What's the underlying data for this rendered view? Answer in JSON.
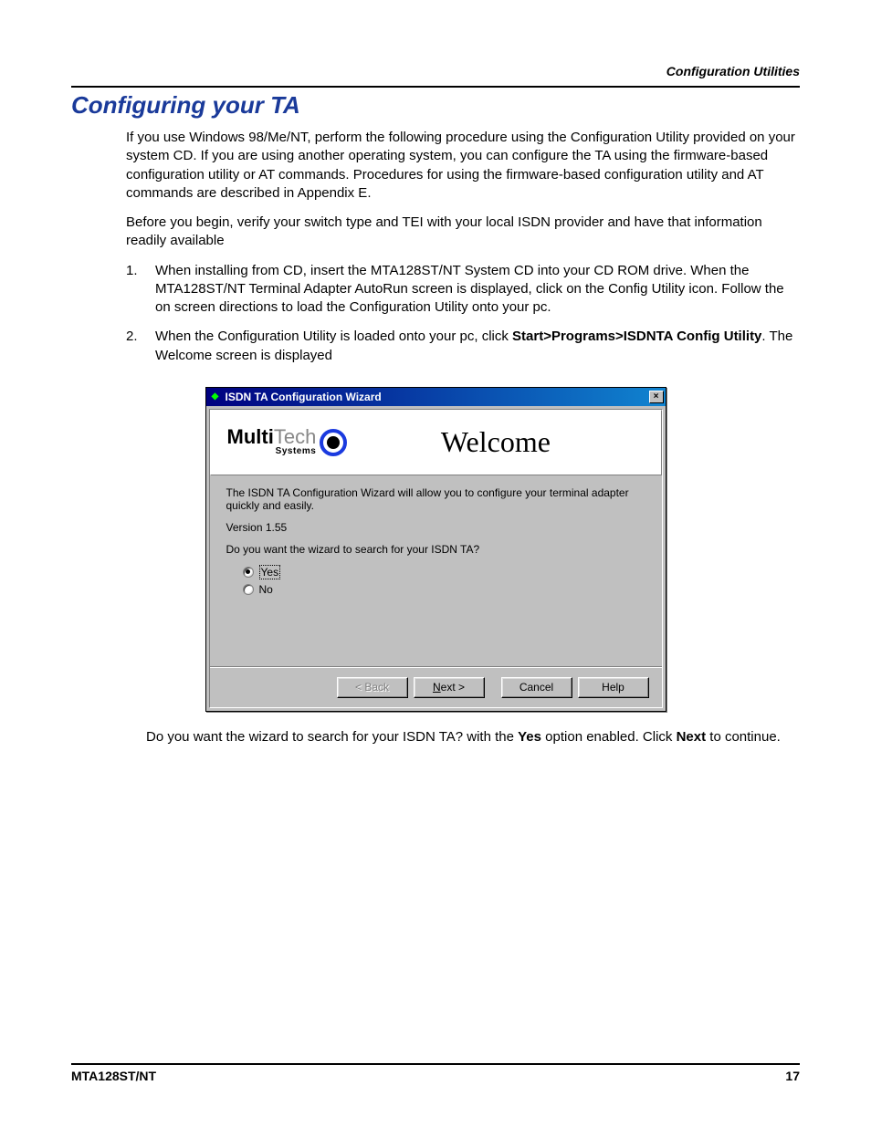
{
  "header": {
    "right": "Configuration Utilities"
  },
  "title": "Configuring your TA",
  "paragraphs": {
    "p1": "If you use Windows 98/Me/NT, perform the following procedure using the Configuration Utility provided on your system CD. If you are using another operating system, you can configure the TA using the firmware-based configuration utility or AT commands.  Procedures for using the firmware-based configuration utility and AT commands are described in Appendix E.",
    "p2": "Before you begin, verify your switch type and TEI with your local ISDN provider and have that information readily available"
  },
  "steps": {
    "s1_num": "1.",
    "s1": "When installing from CD, insert the MTA128ST/NT System CD into your CD ROM drive. When the MTA128ST/NT Terminal Adapter AutoRun screen is displayed, click on the Config Utility icon. Follow the on screen directions to load the Configuration Utility onto your pc.",
    "s2_num": "2.",
    "s2_a": "When the Configuration Utility is loaded onto your pc, click ",
    "s2_bold": "Start>Programs>ISDNTA Config Utility",
    "s2_b": ". The Welcome screen is displayed"
  },
  "wizard": {
    "title": "ISDN TA Configuration Wizard",
    "close": "×",
    "logo_bold": "Multi",
    "logo_thin": "Tech",
    "logo_sub": "Systems",
    "welcome": "Welcome",
    "intro": "The ISDN TA Configuration Wizard will allow you to configure your terminal adapter quickly and easily.",
    "version": "Version 1.55",
    "question": "Do you want the wizard to search for your ISDN TA?",
    "opt_yes": "Yes",
    "opt_no": "No",
    "btn_back": "< Back",
    "btn_next_ul": "N",
    "btn_next_rest": "ext >",
    "btn_cancel": "Cancel",
    "btn_help": "Help"
  },
  "after": {
    "t1": "Do you want the wizard to search for your ISDN TA? with the ",
    "b1": "Yes",
    "t2": " option enabled. Click ",
    "b2": "Next",
    "t3": " to continue."
  },
  "footer": {
    "left": "MTA128ST/NT",
    "right": "17"
  }
}
